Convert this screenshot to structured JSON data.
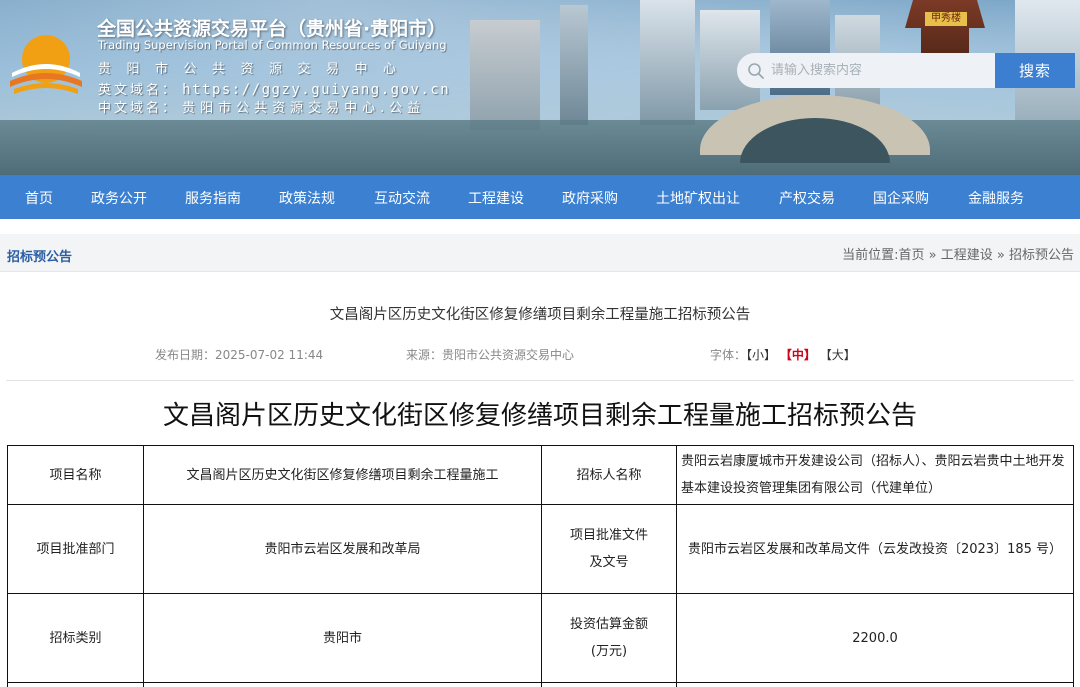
{
  "header": {
    "title": "全国公共资源交易平台（贵州省·贵阳市）",
    "subtitle_en": "Trading Supervision Portal of Common Resources of Guiyang",
    "center_name": "贵阳市公共资源交易中心",
    "en_domain_label": "英文域名：",
    "en_domain": "https://ggzy.guiyang.gov.cn",
    "cn_domain_label": "中文域名：",
    "cn_domain": "贵阳市公共资源交易中心.公益",
    "pavilion_sign": "甲秀楼"
  },
  "search": {
    "placeholder": "请输入搜索内容",
    "button_label": "搜索"
  },
  "nav": {
    "items": [
      "首页",
      "政务公开",
      "服务指南",
      "政策法规",
      "互动交流",
      "工程建设",
      "政府采购",
      "土地矿权出让",
      "产权交易",
      "国企采购",
      "金融服务"
    ]
  },
  "breadcrumb": {
    "section_title": "招标预公告",
    "prefix": "当前位置:",
    "home": "首页",
    "sep": "»",
    "level1": "工程建设",
    "level2": "招标预公告"
  },
  "article": {
    "title": "文昌阁片区历史文化街区修复修缮项目剩余工程量施工招标预公告",
    "publish_date": "发布日期：2025-07-02 11:44",
    "source": "来源：贵阳市公共资源交易中心",
    "font_label": "字体：",
    "font_small": "【小】",
    "font_medium": "【中】",
    "font_large": "【大】",
    "heading": "文昌阁片区历史文化街区修复修缮项目剩余工程量施工招标预公告"
  },
  "table": {
    "rows": [
      {
        "label1": "项目名称",
        "value1": "文昌阁片区历史文化街区修复修缮项目剩余工程量施工",
        "label2": "招标人名称",
        "value2": "贵阳云岩康厦城市开发建设公司（招标人）、贵阳云岩贵中土地开发基本建设投资管理集团有限公司（代建单位）"
      },
      {
        "label1": "项目批准部门",
        "value1": "贵阳市云岩区发展和改革局",
        "label2": "项目批准文件及文号",
        "value2": "贵阳市云岩区发展和改革局文件（云发改投资〔2023〕185 号）"
      },
      {
        "label1": "招标类别",
        "value1": "贵阳市",
        "label2": "投资估算金额(万元)",
        "value2": "2200.0"
      }
    ]
  },
  "colors": {
    "nav_bg": "#3b80d1",
    "search_button": "#3c7fd0",
    "crumb_title": "#2d5ea4",
    "active_font": "#d0021b"
  }
}
